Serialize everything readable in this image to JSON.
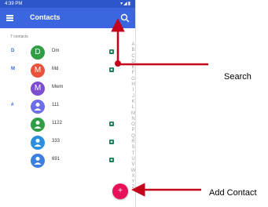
{
  "status_bar": {
    "time": "4:39 PM",
    "icons": "▾◢▮"
  },
  "app_bar": {
    "title": "Contacts",
    "menu_icon": "menu-icon",
    "search_icon": "search-icon"
  },
  "contact_count": "7 contacts",
  "contacts": [
    {
      "section": "D",
      "avatar_letter": "D",
      "name": "Dm",
      "avatar_color": "#2f9e44"
    },
    {
      "section": "M",
      "avatar_letter": "M",
      "name": "Md",
      "avatar_color": "#e8533c"
    },
    {
      "section": "",
      "avatar_letter": "M",
      "name": "Mwm",
      "avatar_color": "#7d4fd0"
    },
    {
      "section": "#",
      "avatar_letter": "",
      "name": "111",
      "avatar_color": "#6c6ee8"
    },
    {
      "section": "",
      "avatar_letter": "",
      "name": "1122",
      "avatar_color": "#2f9e44"
    },
    {
      "section": "",
      "avatar_letter": "",
      "name": "333",
      "avatar_color": "#2a8fde"
    },
    {
      "section": "",
      "avatar_letter": "",
      "name": "691",
      "avatar_color": "#3b7fe0"
    }
  ],
  "alpha_index": [
    "A",
    "B",
    "C",
    "D",
    "E",
    "F",
    "G",
    "H",
    "I",
    "J",
    "K",
    "L",
    "M",
    "N",
    "O",
    "P",
    "Q",
    "R",
    "S",
    "T",
    "U",
    "V",
    "W",
    "X",
    "Y",
    "Z"
  ],
  "fab": {
    "label": "+",
    "color": "#e8105a"
  },
  "annotations": {
    "search": "Search",
    "add_contact": "Add Contact",
    "arrow_color": "#c4001a"
  }
}
